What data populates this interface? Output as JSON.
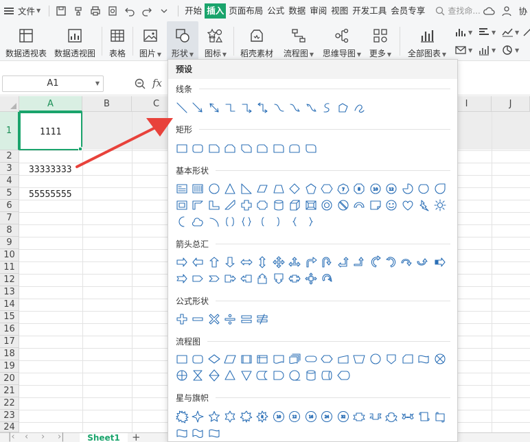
{
  "menubar": {
    "file_label": "文件",
    "tabs": [
      "开始",
      "插入",
      "页面布局",
      "公式",
      "数据",
      "审阅",
      "视图",
      "开发工具",
      "会员专享"
    ],
    "active_tab": "插入",
    "search_placeholder": "查找命...",
    "collab_label": "协"
  },
  "ribbon": {
    "items": [
      {
        "label": "数据透视表",
        "icon": "pivot-table-icon"
      },
      {
        "label": "数据透视图",
        "icon": "pivot-chart-icon"
      },
      {
        "label": "表格",
        "icon": "table-icon"
      },
      {
        "label": "图片",
        "icon": "picture-icon"
      },
      {
        "label": "形状",
        "icon": "shapes-icon"
      },
      {
        "label": "图标",
        "icon": "icons-icon"
      },
      {
        "label": "稻壳素材",
        "icon": "docer-icon"
      },
      {
        "label": "流程图",
        "icon": "flowchart-icon"
      },
      {
        "label": "思维导图",
        "icon": "mindmap-icon"
      },
      {
        "label": "更多",
        "icon": "more-icon"
      },
      {
        "label": "全部图表",
        "icon": "all-charts-icon"
      }
    ]
  },
  "formula": {
    "cell_ref": "A1",
    "fx": "fx"
  },
  "grid": {
    "columns": [
      "A",
      "B",
      "C",
      "",
      "",
      "",
      "",
      "I",
      "J"
    ],
    "rows": [
      "1",
      "2",
      "3",
      "4",
      "5",
      "6",
      "7",
      "8",
      "9",
      "10",
      "11",
      "12",
      "13",
      "14",
      "15",
      "16",
      "17",
      "18",
      "19",
      "20",
      "21",
      "22",
      "23",
      "24"
    ],
    "cells": {
      "A1": "1111",
      "A3": "33333333",
      "A5": "55555555"
    }
  },
  "sheets": {
    "tabs": [
      "Sheet1"
    ],
    "add": "+"
  },
  "shapes_panel": {
    "title": "预设",
    "sections": [
      {
        "title": "线条"
      },
      {
        "title": "矩形"
      },
      {
        "title": "基本形状"
      },
      {
        "title": "箭头总汇"
      },
      {
        "title": "公式形状"
      },
      {
        "title": "流程图"
      },
      {
        "title": "星与旗帜"
      }
    ]
  },
  "colors": {
    "accent": "#1aa46c",
    "shape_stroke": "#2b6fb6",
    "annotation_arrow": "#e8423b"
  }
}
